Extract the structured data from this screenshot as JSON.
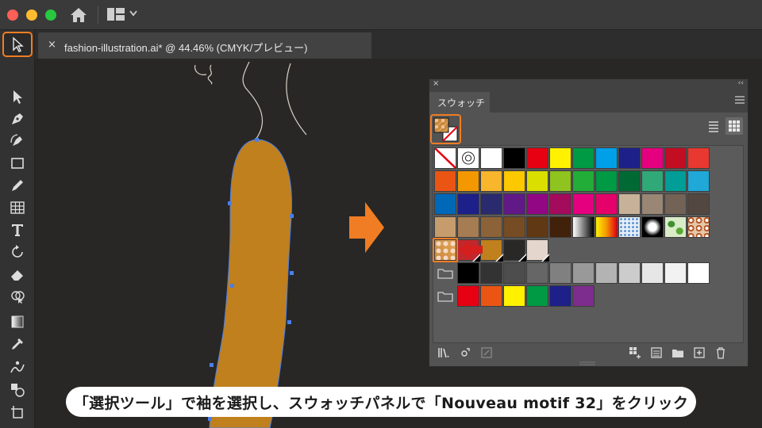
{
  "window": {
    "document_tab_title": "fashion-illustration.ai* @ 44.46% (CMYK/プレビュー)",
    "close_glyph": "×"
  },
  "toolbar": {
    "collapse_glyph": "››",
    "tools": [
      "selection-tool",
      "direct-selection-tool",
      "pen-tool",
      "curvature-tool",
      "rectangle-tool",
      "pencil-tool",
      "grid-tool",
      "type-tool",
      "rotate-tool",
      "eraser-tool",
      "shape-builder-tool",
      "gradient-tool",
      "eyedropper-tool",
      "puppet-warp-tool",
      "blend-tool",
      "artboard-tool"
    ],
    "active_tool": "selection-tool"
  },
  "swatches_panel": {
    "close_glyph": "×",
    "collapse_glyph": "‹‹",
    "tab_label": "スウォッチ",
    "rows": [
      [
        "none",
        "registration",
        "#ffffff",
        "#000000",
        "#e60012",
        "#fff100",
        "#009944",
        "#00a0e9",
        "#1d2088",
        "#e4007f",
        "#c30d23",
        "#e8382f"
      ],
      [
        "#ea5514",
        "#f39800",
        "#f8b62d",
        "#fcc800",
        "#dadf00",
        "#8fc31f",
        "#22ac38",
        "#009944",
        "#006934",
        "#31a877",
        "#009e96",
        "#1fa8d8"
      ],
      [
        "#0068b7",
        "#1d2088",
        "#2a2a6e",
        "#601986",
        "#920783",
        "#a40b5d",
        "#e4007f",
        "#e5006a",
        "#c7b299",
        "#998675",
        "#736357",
        "#534741"
      ],
      [
        "#c69c6d",
        "#a67c52",
        "#8c6239",
        "#754c24",
        "#603813",
        "#42210b",
        "gradient-bw",
        "gradient-fire",
        "pattern-dots-blue",
        "pattern-radial",
        "pattern-leaf",
        "pattern-swirl"
      ],
      [
        "pattern-nouveau",
        "#c1272d",
        "#c0801d",
        "#2a2826",
        "#e4d6cc"
      ],
      [
        "folder",
        "#000000",
        "#333333",
        "#4d4d4d",
        "#666666",
        "#808080",
        "#999999",
        "#b3b3b3",
        "#cccccc",
        "#e6e6e6",
        "#f2f2f2",
        "#ffffff"
      ],
      [
        "folder",
        "#e60012",
        "#ea5514",
        "#fff100",
        "#009944",
        "#1d2088",
        "#7d2d8d"
      ]
    ],
    "highlighted_swatch": "Nouveau motif 32",
    "bottom_icons": [
      "swatch-library-icon",
      "show-swatch-kinds-icon",
      "swatch-options-icon",
      "new-color-group-icon",
      "edit-color-group-icon",
      "new-folder-icon",
      "new-swatch-icon",
      "delete-swatch-icon"
    ]
  },
  "colors": {
    "accent_orange": "#f07d23",
    "fill_color": "#c0801d",
    "selection_blue": "#4a7fe8"
  },
  "caption": {
    "text": "「選択ツール」で袖を選択し、スウォッチパネルで「Nouveau motif 32」をクリック"
  }
}
